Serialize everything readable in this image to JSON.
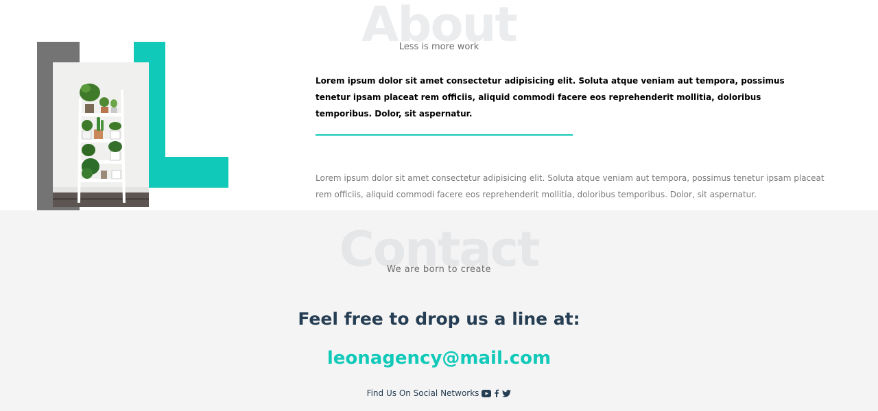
{
  "about": {
    "bg_title": "About",
    "subtitle": "Less is more work",
    "bold_paragraph": "Lorem ipsum dolor sit amet consectetur adipisicing elit. Soluta atque veniam aut tempora, possimus tenetur ipsam placeat rem officiis, aliquid commodi facere eos reprehenderit mollitia, doloribus temporibus. Dolor, sit aspernatur.",
    "paragraph": "Lorem ipsum dolor sit amet consectetur adipisicing elit. Soluta atque veniam aut tempora, possimus tenetur ipsam placeat rem officiis, aliquid commodi facere eos reprehenderit mollitia, doloribus temporibus. Dolor, sit aspernatur."
  },
  "contact": {
    "bg_title": "Contact",
    "subtitle": "We are born to create",
    "heading": "Feel free to drop us a line at:",
    "email": "leonagency@mail.com",
    "social_label": "Find Us On Social Networks",
    "social_icons": [
      "youtube-icon",
      "facebook-icon",
      "twitter-icon"
    ]
  },
  "colors": {
    "accent": "#10c9b8",
    "dark_text": "#263e53",
    "gray_block": "#747474",
    "contact_bg": "#f4f4f4"
  }
}
